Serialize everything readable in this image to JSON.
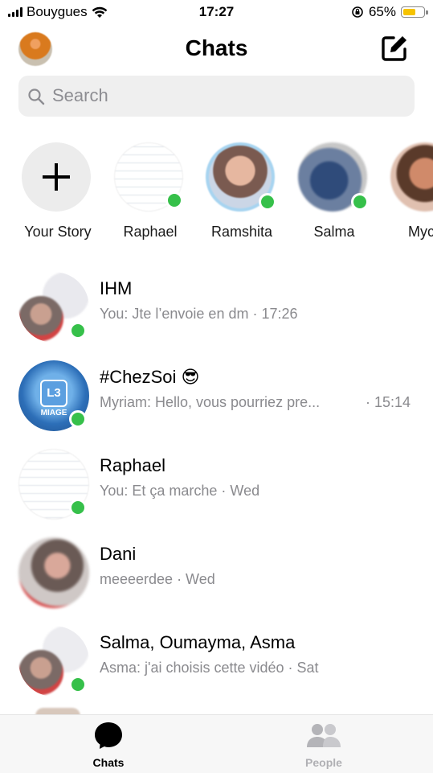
{
  "status_bar": {
    "carrier": "Bouygues",
    "time": "17:27",
    "battery_percent": "65%",
    "battery_level": 0.65
  },
  "header": {
    "title": "Chats"
  },
  "search": {
    "placeholder": "Search"
  },
  "stories": [
    {
      "label": "Your Story"
    },
    {
      "label": "Raphael"
    },
    {
      "label": "Ramshita"
    },
    {
      "label": "Salma"
    },
    {
      "label": "Myc"
    }
  ],
  "conversations": [
    {
      "name": "IHM",
      "preview": "You: Jte l’envoie en dm · 17:26",
      "time": ""
    },
    {
      "name": "#ChezSoi 😎",
      "preview": "Myriam: Hello, vous pourriez pre...",
      "time": "· 15:14",
      "avatar_text": "L3",
      "avatar_subtext": "MIAGE"
    },
    {
      "name": "Raphael",
      "preview": "You: Et ça marche · Wed",
      "time": ""
    },
    {
      "name": "Dani",
      "preview": "meeeerdee · Wed",
      "time": ""
    },
    {
      "name": "Salma, Oumayma, Asma",
      "preview": "Asma: j'ai choisis cette vidéo · Sat",
      "time": ""
    }
  ],
  "tabbar": {
    "chats": "Chats",
    "people": "People"
  },
  "colors": {
    "online": "#36c04a",
    "battery": "#f6c300",
    "secondary_text": "#8a8a8e",
    "search_bg": "#efefef"
  }
}
